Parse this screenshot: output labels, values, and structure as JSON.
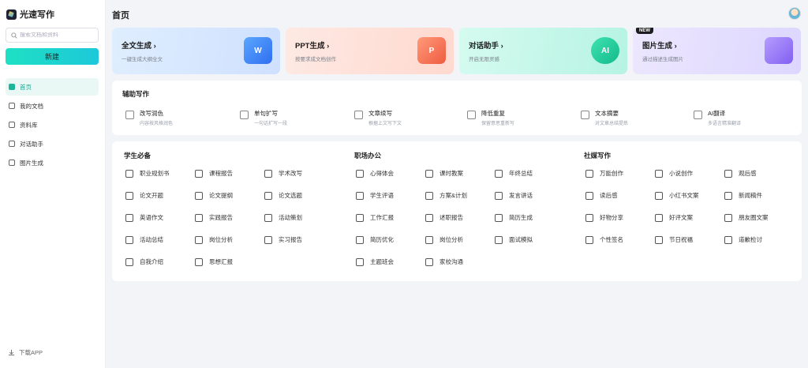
{
  "app": {
    "name": "光速写作"
  },
  "sidebar": {
    "search_placeholder": "搜索文档和资料",
    "new_button": "新建",
    "items": [
      {
        "label": "首页",
        "icon": "home-icon",
        "active": true
      },
      {
        "label": "我的文档",
        "icon": "document-icon",
        "active": false
      },
      {
        "label": "资料库",
        "icon": "library-icon",
        "active": false
      },
      {
        "label": "对话助手",
        "icon": "chat-icon",
        "active": false
      },
      {
        "label": "图片生成",
        "icon": "image-icon",
        "active": false
      }
    ],
    "download": "下载APP"
  },
  "header": {
    "title": "首页"
  },
  "cards": [
    {
      "title": "全文生成",
      "subtitle": "一键生成大纲全文",
      "icon": "document-w-icon",
      "glyph": "W"
    },
    {
      "title": "PPT生成",
      "subtitle": "按要求成文档创作",
      "icon": "presentation-icon",
      "glyph": "P"
    },
    {
      "title": "对话助手",
      "subtitle": "开启无限灵感",
      "icon": "ai-chat-icon",
      "glyph": "AI"
    },
    {
      "title": "图片生成",
      "subtitle": "通过描述生成图片",
      "icon": "picture-icon",
      "glyph": "",
      "badge": "NEW"
    }
  ],
  "assist": {
    "title": "辅助写作",
    "items": [
      {
        "name": "改写润色",
        "desc": "内容按风格润色"
      },
      {
        "name": "单句扩写",
        "desc": "一句话扩写一段"
      },
      {
        "name": "文章续写",
        "desc": "根据上文写下文"
      },
      {
        "name": "降低重复",
        "desc": "保留意思重新写"
      },
      {
        "name": "文本摘要",
        "desc": "对文章总结提炼"
      },
      {
        "name": "AI翻译",
        "desc": "多语言精准翻译"
      }
    ]
  },
  "categories": [
    {
      "title": "学生必备",
      "items": [
        "职业规划书",
        "课程报告",
        "学术改写",
        "论文开题",
        "论文提纲",
        "论文选题",
        "英语作文",
        "实践报告",
        "活动策划",
        "活动总结",
        "岗位分析",
        "实习报告",
        "自我介绍",
        "思想汇报"
      ]
    },
    {
      "title": "职场办公",
      "items": [
        "心得体会",
        "课时教案",
        "年终总结",
        "学生评语",
        "方案&计划",
        "发言讲话",
        "工作汇报",
        "述职报告",
        "简历生成",
        "简历优化",
        "岗位分析",
        "面试模拟",
        "主题班会",
        "家校沟通"
      ]
    },
    {
      "title": "社媒写作",
      "items": [
        "万能创作",
        "小说创作",
        "观后感",
        "读后感",
        "小红书文案",
        "新闻稿件",
        "好物分享",
        "好评文案",
        "朋友圈文案",
        "个性签名",
        "节日祝福",
        "道歉检讨"
      ]
    }
  ]
}
